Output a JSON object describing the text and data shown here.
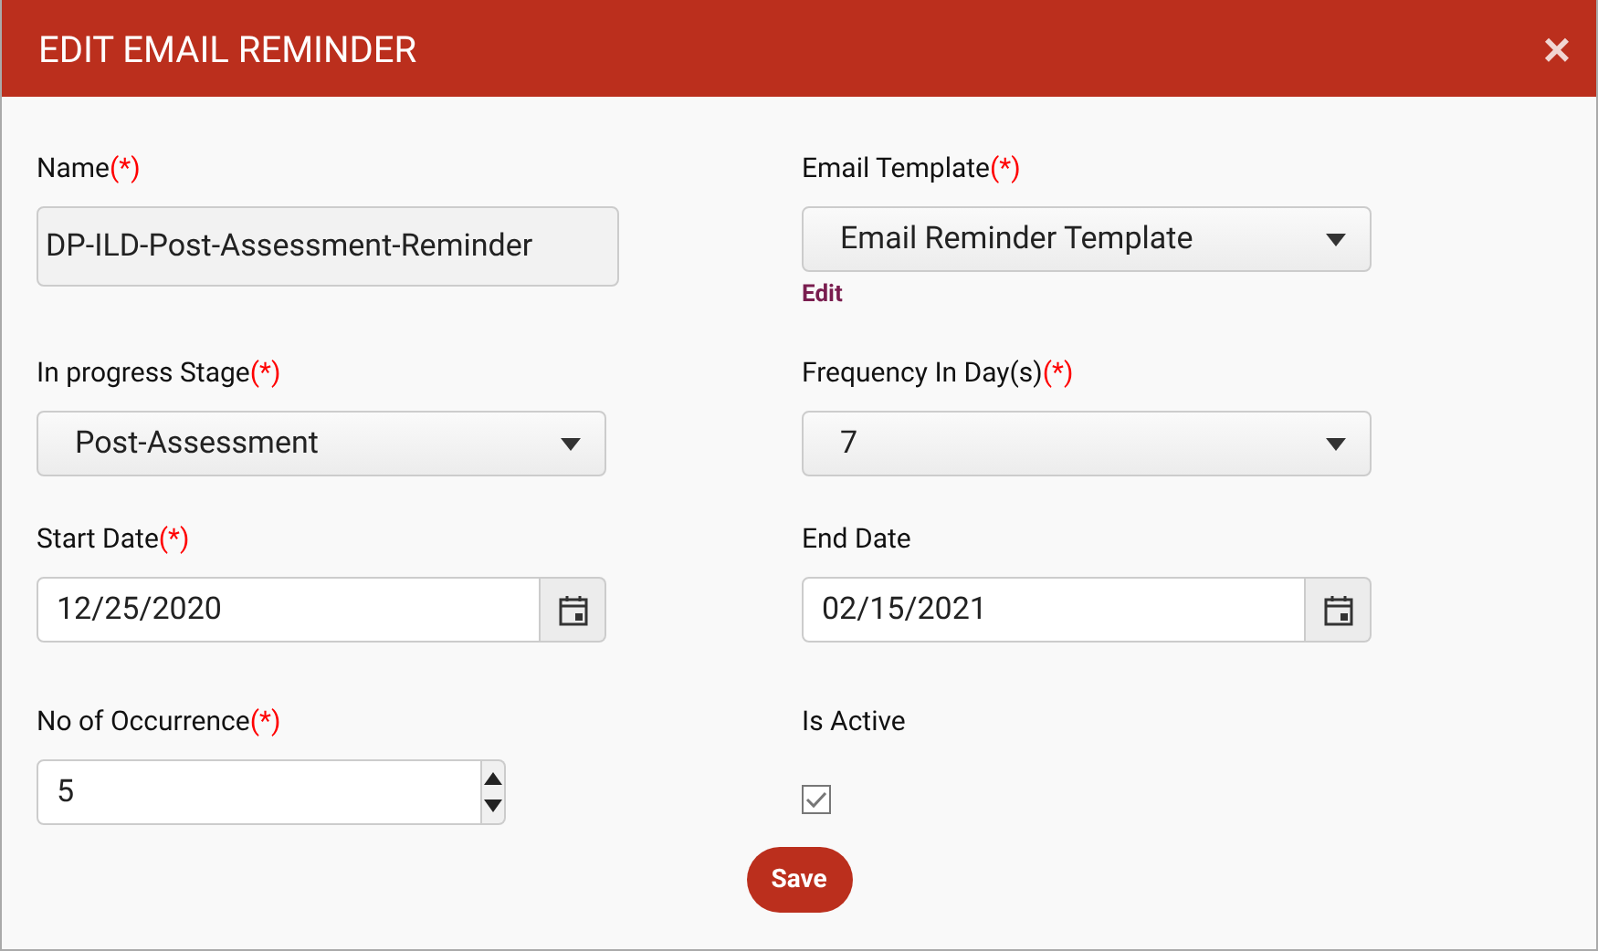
{
  "dialog": {
    "title": "EDIT EMAIL REMINDER",
    "close": "×"
  },
  "rows": [
    [
      {
        "kind": "text",
        "label": "Name",
        "required": "(*)",
        "value": "DP-ILD-Post-Assessment-Reminder",
        "disabled": true
      },
      {
        "kind": "select",
        "label": "Email Template",
        "required": "(*)",
        "value": "Email Reminder Template",
        "link": "Edit"
      }
    ],
    [
      {
        "kind": "select",
        "label": "In progress Stage",
        "required": "(*)",
        "value": "Post-Assessment"
      },
      {
        "kind": "select",
        "label": "Frequency In Day(s)",
        "required": "(*)",
        "value": "7"
      }
    ],
    [
      {
        "kind": "date",
        "label": "Start Date",
        "required": "(*)",
        "value": "12/25/2020"
      },
      {
        "kind": "date",
        "label": "End Date",
        "value": "02/15/2021"
      }
    ],
    [
      {
        "kind": "number",
        "label": "No of Occurrence",
        "required": "(*)",
        "value": "5"
      },
      {
        "kind": "checkbox",
        "label": "Is Active",
        "checked": true
      }
    ]
  ],
  "save_button": "Save"
}
